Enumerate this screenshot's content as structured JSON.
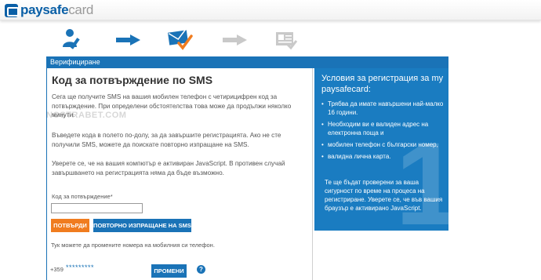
{
  "header": {
    "logo_bold": "paysafe",
    "logo_light": "card",
    "brand_color": "#0a5fa6"
  },
  "steps": {
    "items": [
      {
        "icon": "user-pen-icon",
        "state": "done"
      },
      {
        "icon": "arrow-right-icon",
        "state": "done"
      },
      {
        "icon": "envelope-check-icon",
        "state": "current"
      },
      {
        "icon": "arrow-right-icon",
        "state": "pending"
      },
      {
        "icon": "document-check-icon",
        "state": "pending"
      }
    ],
    "active_color": "#1a73b7",
    "inactive_color": "#c9c9c9"
  },
  "tab": {
    "label": "Верифициране"
  },
  "main": {
    "title": "Код за потвърждение по SMS",
    "para1": "Сега ще получите SMS на вашия мобилен телефон с четирицифрен код за потвърждение. При определени обстоятелства това може да продължи няколко минути.",
    "para2": "Въведете кода в полето по-долу, за да завършите регистрацията. Ако не сте получили SMS, можете да поискате повторно изпращане на SMS.",
    "para3": "Уверете се, че на вашия компютър е активиран JavaScript. В противен случай завършването на регистрацията няма да бъде възможно.",
    "code_label": "Код за потвърждение*",
    "code_value": "",
    "confirm_button": "ПОТВЪРДИ",
    "resend_button": "ПОВТОРНО ИЗПРАЩАНЕ НА SMS",
    "change_text": "Тук можете да промените номера на мобилния си телефон.",
    "phone_prefix": "+359",
    "phone_mask": "*********",
    "change_button": "ПРОМЕНИ",
    "help_symbol": "?"
  },
  "watermark": "NOSTRABET.COM",
  "sidebar": {
    "title": "Условия за регистрация за my paysafecard:",
    "items": [
      "Трябва да имате навършени най-малко 16 години.",
      "Необходим ви е валиден адрес на електронна поща и",
      "мобилен телефон с български номер,",
      " валидна лична карта."
    ],
    "note": "Те ще бъдат проверени за ваша сигурност по време на процеса на регистриране. Уверете се, че във вашия браузър е активирано JavaScript.",
    "big_digit": "1"
  },
  "colors": {
    "accent": "#1a73b7",
    "orange": "#f07c1f",
    "panel": "#1a7cc1"
  }
}
